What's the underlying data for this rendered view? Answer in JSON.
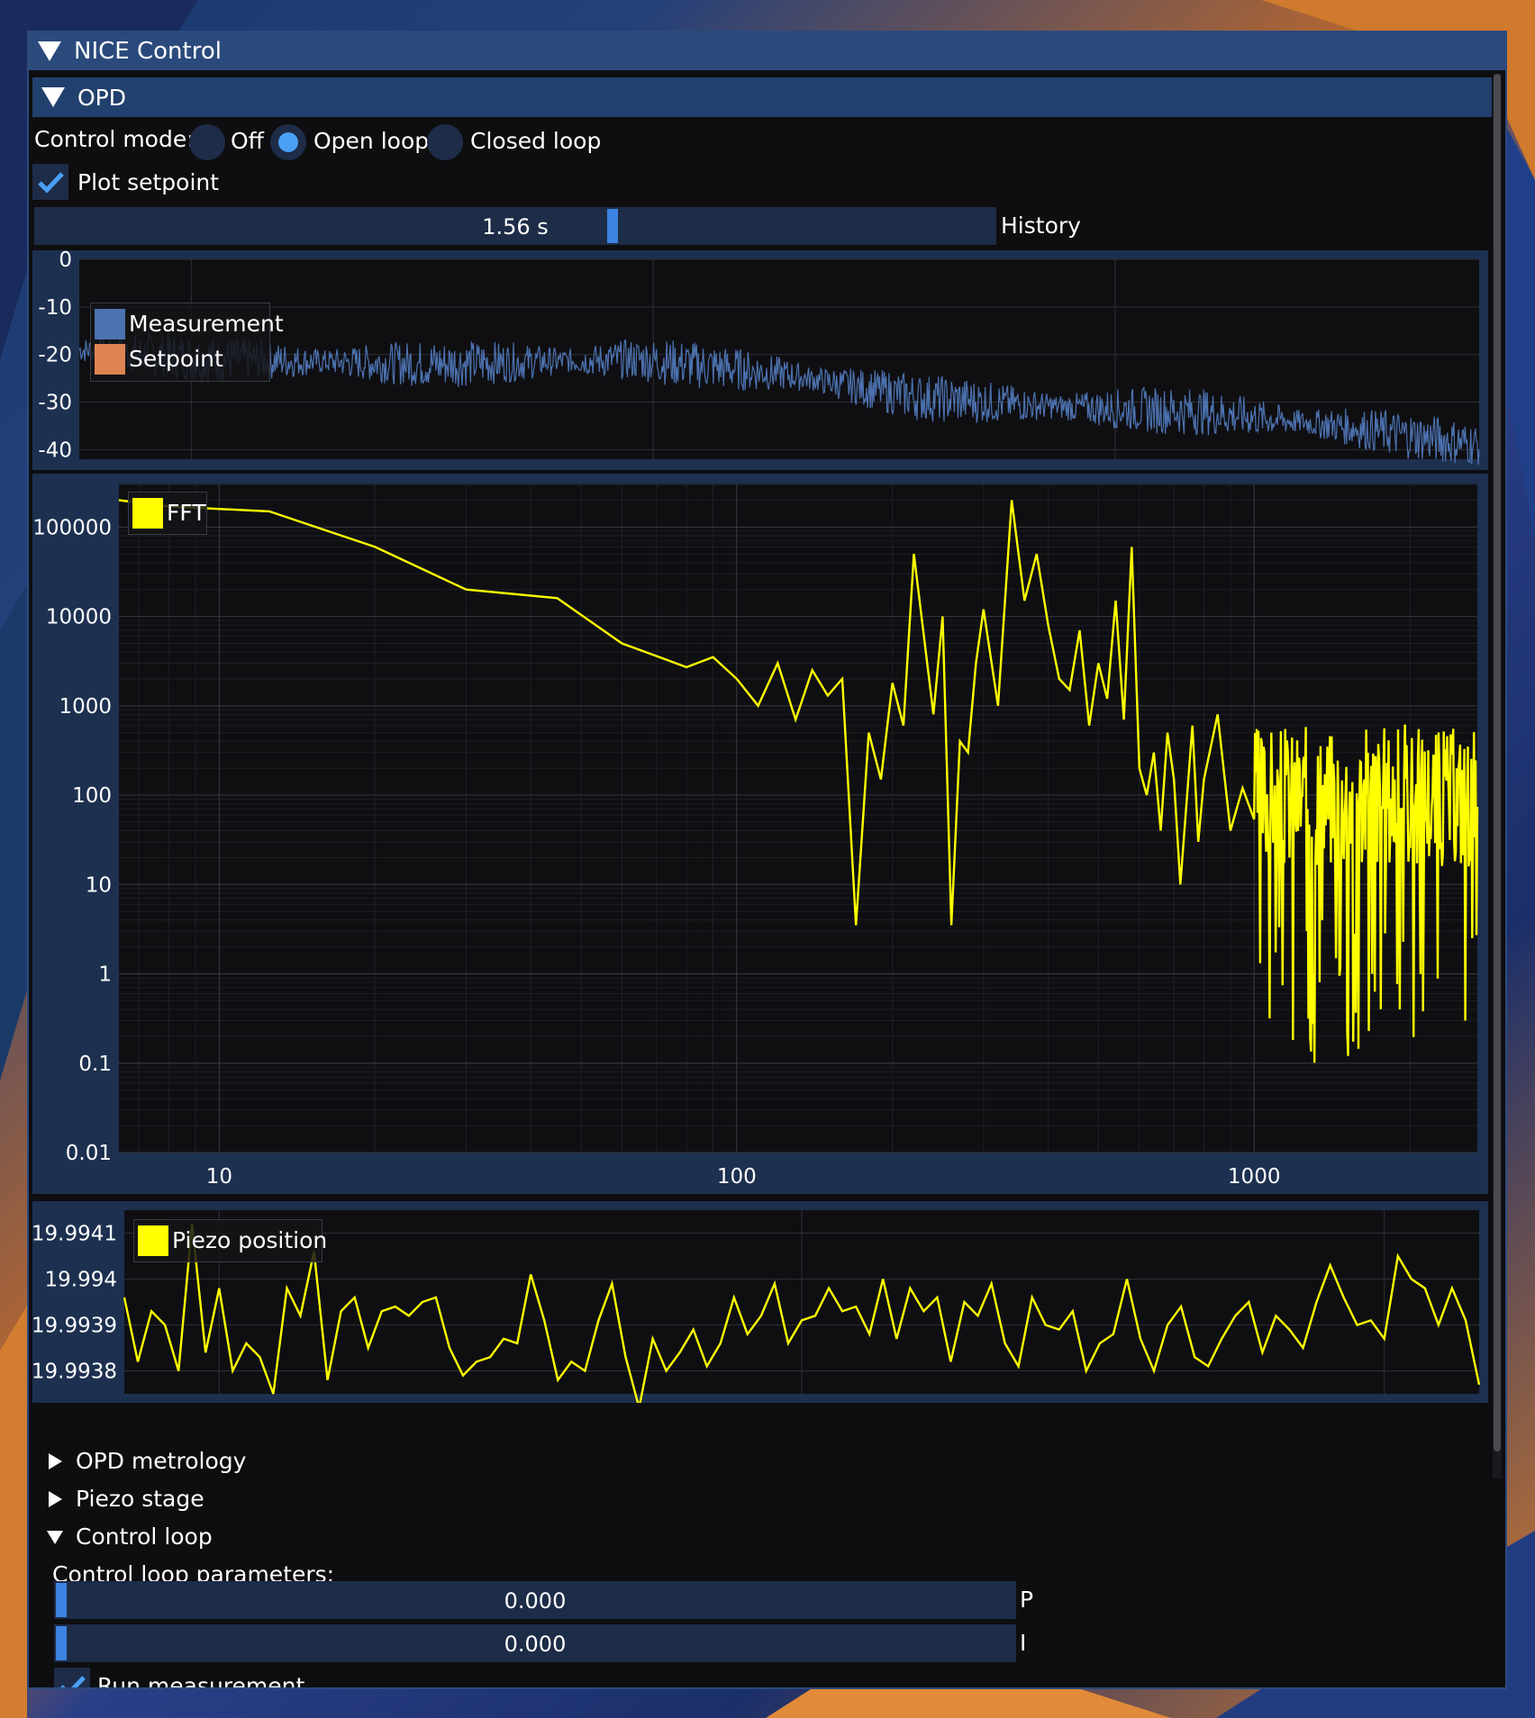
{
  "window": {
    "title": "NICE Control"
  },
  "opd": {
    "header": "OPD",
    "control_mode_label": "Control mode:",
    "modes": [
      "Off",
      "Open loop",
      "Closed loop"
    ],
    "selected_mode": "Open loop",
    "plot_setpoint_label": "Plot setpoint",
    "plot_setpoint_checked": true,
    "history": {
      "value": "1.56 s",
      "label": "History"
    }
  },
  "plot1": {
    "y_ticks": [
      "0",
      "-10",
      "-20",
      "-30",
      "-40"
    ],
    "legend": [
      "Measurement",
      "Setpoint"
    ],
    "legend_colors": [
      "#4c72b0",
      "#dd8452"
    ]
  },
  "plot2": {
    "y_ticks": [
      "100000",
      "10000",
      "1000",
      "100",
      "10",
      "1",
      "0.1",
      "0.01"
    ],
    "x_ticks": [
      "10",
      "100",
      "1000"
    ],
    "legend": [
      "FFT"
    ],
    "legend_color": "#ffff00"
  },
  "plot3": {
    "y_ticks": [
      "19.9941",
      "19.994",
      "19.9939",
      "19.9938"
    ],
    "legend": [
      "Piezo position"
    ],
    "legend_color": "#ffff00"
  },
  "sections": {
    "opd_metrology": "OPD metrology",
    "piezo_stage": "Piezo stage",
    "control_loop": "Control loop"
  },
  "control_loop": {
    "params_label": "Control loop parameters:",
    "p_value": "0.000",
    "p_label": "P",
    "i_value": "0.000",
    "i_label": "I",
    "run_label": "Run measurement"
  },
  "chart_data": [
    {
      "type": "line",
      "ylim": [
        -42,
        0
      ],
      "series": [
        {
          "name": "Measurement",
          "trend_x": [
            0,
            0.1,
            0.25,
            0.4,
            0.5,
            0.6,
            0.7,
            0.8,
            0.9,
            1.0
          ],
          "trend_y": [
            -19,
            -21,
            -22,
            -21,
            -24,
            -29,
            -31,
            -32,
            -35,
            -39
          ]
        },
        {
          "name": "Setpoint",
          "trend_x": [],
          "trend_y": []
        }
      ]
    },
    {
      "type": "line",
      "xscale": "log",
      "yscale": "log",
      "xlim": [
        6.4,
        2700
      ],
      "ylim": [
        0.01,
        300000
      ],
      "series": [
        {
          "name": "FFT",
          "x": [
            6.4,
            8,
            12.5,
            20,
            30,
            45,
            60,
            70,
            80,
            90,
            100,
            110,
            120,
            130,
            140,
            150,
            160,
            170,
            180,
            190,
            200,
            210,
            220,
            240,
            250,
            260,
            270,
            280,
            290,
            300,
            320,
            340,
            360,
            380,
            400,
            420,
            440,
            460,
            480,
            500,
            520,
            540,
            560,
            580,
            600,
            620,
            640,
            660,
            680,
            700,
            720,
            740,
            760,
            780,
            800,
            850,
            900,
            950,
            1000,
            1050,
            1100,
            1150,
            1200,
            1250,
            1300,
            1350,
            1400,
            1450,
            1500,
            1600,
            1700,
            1800,
            1900,
            2000,
            2100,
            2200,
            2300,
            2400,
            2500,
            2600,
            2700
          ],
          "y": [
            200000,
            170000,
            150000,
            60000,
            20000,
            16000,
            5000,
            3600,
            2700,
            3500,
            2000,
            1000,
            3000,
            700,
            2500,
            1300,
            2000,
            3.5,
            500,
            150,
            1800,
            600,
            50000,
            800,
            10000,
            3.5,
            400,
            300,
            3000,
            12000,
            1000,
            200000,
            15000,
            50000,
            8000,
            2000,
            1500,
            7000,
            600,
            3000,
            1200,
            15000,
            700,
            60000,
            200,
            100,
            300,
            40,
            500,
            150,
            10,
            80,
            600,
            30,
            150,
            800,
            40,
            120,
            1.2,
            300,
            60,
            30,
            600,
            4,
            120,
            20,
            80,
            300,
            3,
            150,
            0.2,
            200,
            1,
            60,
            400,
            3,
            100,
            8,
            150,
            0.3,
            60
          ]
        }
      ]
    },
    {
      "type": "line",
      "ylim": [
        19.99375,
        19.99415
      ],
      "series": [
        {
          "name": "Piezo position",
          "x": [
            0,
            0.01,
            0.02,
            0.03,
            0.04,
            0.05,
            0.06,
            0.07,
            0.08,
            0.09,
            0.1,
            0.11,
            0.12,
            0.13,
            0.14,
            0.15,
            0.16,
            0.17,
            0.18,
            0.19,
            0.2,
            0.21,
            0.22,
            0.23,
            0.24,
            0.25,
            0.26,
            0.27,
            0.28,
            0.29,
            0.3,
            0.31,
            0.32,
            0.33,
            0.34,
            0.35,
            0.36,
            0.37,
            0.38,
            0.39,
            0.4,
            0.41,
            0.42,
            0.43,
            0.44,
            0.45,
            0.46,
            0.47,
            0.48,
            0.49,
            0.5,
            0.51,
            0.52,
            0.53,
            0.54,
            0.55,
            0.56,
            0.57,
            0.58,
            0.59,
            0.6,
            0.61,
            0.62,
            0.63,
            0.64,
            0.65,
            0.66,
            0.67,
            0.68,
            0.69,
            0.7,
            0.71,
            0.72,
            0.73,
            0.74,
            0.75,
            0.76,
            0.77,
            0.78,
            0.79,
            0.8,
            0.81,
            0.82,
            0.83,
            0.84,
            0.85,
            0.86,
            0.87,
            0.88,
            0.89,
            0.9,
            0.91,
            0.92,
            0.93,
            0.94,
            0.95,
            0.96,
            0.97,
            0.98,
            0.99,
            1.0
          ],
          "y": [
            19.99396,
            19.99382,
            19.99393,
            19.9939,
            19.9938,
            19.99412,
            19.99384,
            19.99398,
            19.9938,
            19.99386,
            19.99383,
            19.99375,
            19.99398,
            19.99392,
            19.99406,
            19.99378,
            19.99393,
            19.99396,
            19.99385,
            19.99393,
            19.99394,
            19.99392,
            19.99395,
            19.99396,
            19.99385,
            19.99379,
            19.99382,
            19.99383,
            19.99387,
            19.99386,
            19.99401,
            19.99391,
            19.99378,
            19.99382,
            19.9938,
            19.99391,
            19.99399,
            19.99383,
            19.99372,
            19.99387,
            19.9938,
            19.99384,
            19.99389,
            19.99381,
            19.99386,
            19.99396,
            19.99388,
            19.99392,
            19.99399,
            19.99386,
            19.99391,
            19.99392,
            19.99398,
            19.99393,
            19.99394,
            19.99388,
            19.994,
            19.99387,
            19.99398,
            19.99393,
            19.99396,
            19.99382,
            19.99395,
            19.99392,
            19.99399,
            19.99386,
            19.99381,
            19.99396,
            19.9939,
            19.99389,
            19.99393,
            19.9938,
            19.99386,
            19.99388,
            19.994,
            19.99387,
            19.9938,
            19.9939,
            19.99394,
            19.99383,
            19.99381,
            19.99387,
            19.99392,
            19.99395,
            19.99384,
            19.99392,
            19.99389,
            19.99385,
            19.99395,
            19.99403,
            19.99396,
            19.9939,
            19.99391,
            19.99387,
            19.99405,
            19.994,
            19.99398,
            19.9939,
            19.99398,
            19.99391,
            19.99377
          ]
        }
      ]
    }
  ]
}
